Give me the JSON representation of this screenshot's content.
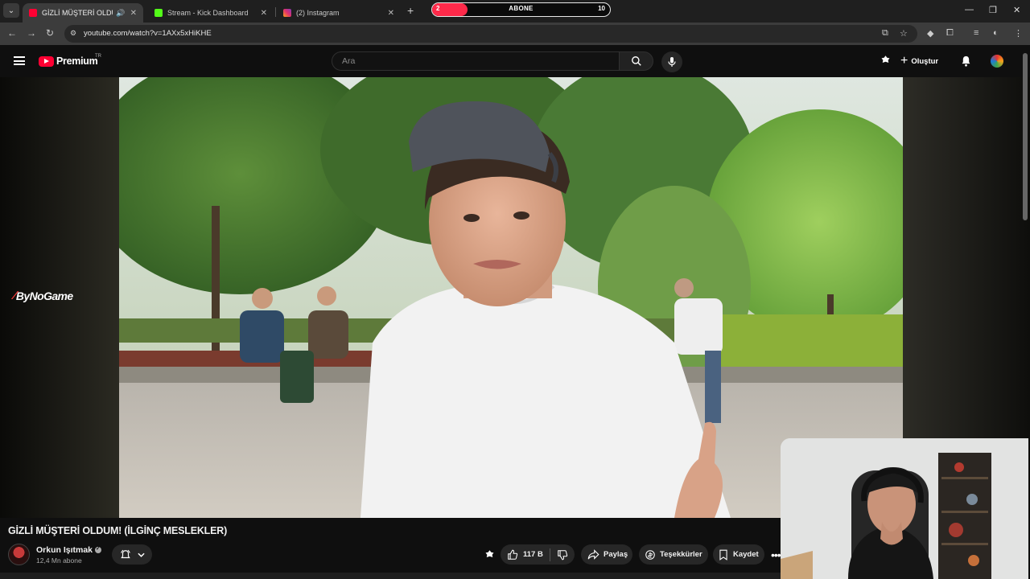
{
  "browser": {
    "tabs": [
      {
        "title": "GİZLİ MÜŞTERİ OLDUM! (İLG",
        "favicon": "youtube-favicon",
        "active": true,
        "audio": true
      },
      {
        "title": "Stream - Kick Dashboard",
        "favicon": "kick-favicon",
        "active": false
      },
      {
        "title": "(2) Instagram",
        "favicon": "instagram-favicon",
        "active": false
      }
    ],
    "new_tab_label": "+",
    "url": "youtube.com/watch?v=1AXx5xHiKHE"
  },
  "sub_goal": {
    "label": "ABONE",
    "current": "2",
    "goal": "10",
    "progress": 0.2,
    "accent": "#ff2a4a"
  },
  "youtube": {
    "logo_text": "Premium",
    "country_code": "TR",
    "search_placeholder": "Ara",
    "create_label": "Oluştur",
    "accent": "#ff0033"
  },
  "video": {
    "title": "GİZLİ MÜŞTERİ OLDUM! (İLGİNÇ MESLEKLER)",
    "sponsor_overlay": "ByNoGame"
  },
  "channel": {
    "name": "Orkun Işıtmak",
    "subscribers": "12,4 Mn abone"
  },
  "actions": {
    "likes": "117 B",
    "share": "Paylaş",
    "thanks": "Teşekkürler",
    "save": "Kaydet"
  }
}
